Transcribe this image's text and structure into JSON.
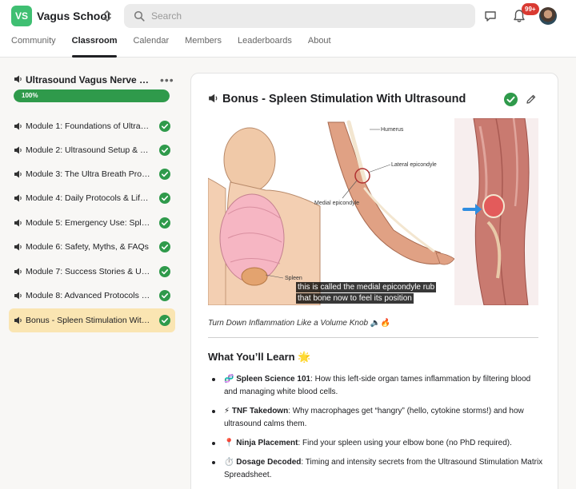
{
  "header": {
    "logo_text": "VS",
    "school_name": "Vagus School",
    "search_placeholder": "Search",
    "notification_badge": "99+",
    "tabs": [
      {
        "label": "Community"
      },
      {
        "label": "Classroom"
      },
      {
        "label": "Calendar"
      },
      {
        "label": "Members"
      },
      {
        "label": "Leaderboards"
      },
      {
        "label": "About"
      }
    ],
    "active_tab": "Classroom"
  },
  "sidebar": {
    "course_title": "Ultrasound Vagus Nerve Stim...",
    "progress_percent": 100,
    "progress_label": "100%",
    "modules": [
      {
        "label": "Module 1: Foundations of Ultras...",
        "completed": true
      },
      {
        "label": "Module 2: Ultrasound Setup & Ne...",
        "completed": true
      },
      {
        "label": "Module 3: The Ultra Breath Proto...",
        "completed": true
      },
      {
        "label": "Module 4: Daily Protocols & Lifes...",
        "completed": true
      },
      {
        "label": "Module 5: Emergency Use: Splee...",
        "completed": true
      },
      {
        "label": "Module 6: Safety, Myths, & FAQs",
        "completed": true
      },
      {
        "label": "Module 7: Success Stories & Use...",
        "completed": true
      },
      {
        "label": "Module 8: Advanced Protocols & ...",
        "completed": true
      },
      {
        "label": "Bonus - Spleen Stimulation With ...",
        "completed": true,
        "active": true
      }
    ]
  },
  "lesson": {
    "title": "Bonus - Spleen Stimulation With Ultrasound",
    "video": {
      "labels": {
        "spleen": "Spleen",
        "humerus": "Humerus",
        "lateral_epicondyle": "Lateral epicondyle",
        "medial_epicondyle": "Medial epicondyle"
      },
      "caption_line1": "this is called the medial epicondyle rub",
      "caption_line2": "that bone now to feel its position"
    },
    "subtitle": "Turn Down Inflammation Like a Volume Knob 🔈🔥",
    "learn_heading": "What You’ll Learn 🌟",
    "learn_items": [
      {
        "emoji": "🧬",
        "bold": "Spleen Science 101",
        "text": ": How this left-side organ tames inflammation by filtering blood and managing white blood cells."
      },
      {
        "emoji": "⚡",
        "bold": "TNF Takedown",
        "text": ": Why macrophages get “hangry” (hello, cytokine storms!) and how ultrasound calms them."
      },
      {
        "emoji": "📍",
        "bold": "Ninja Placement",
        "text": ": Find your spleen using your elbow bone (no PhD required)."
      },
      {
        "emoji": "⏱️",
        "bold": "Dosage Decoded",
        "text": ": Timing and intensity secrets from the Ultrasound Stimulation Matrix Spreadsheet."
      }
    ]
  },
  "colors": {
    "brand_green": "#3fbf72",
    "complete_green": "#2f9a4b",
    "active_module_bg": "#fae5b2",
    "badge_red": "#d93a32"
  },
  "icons": [
    "search-icon",
    "chat-icon",
    "bell-icon",
    "speaker-icon",
    "check-circle-icon",
    "edit-icon",
    "more-icon",
    "switcher-icon"
  ]
}
